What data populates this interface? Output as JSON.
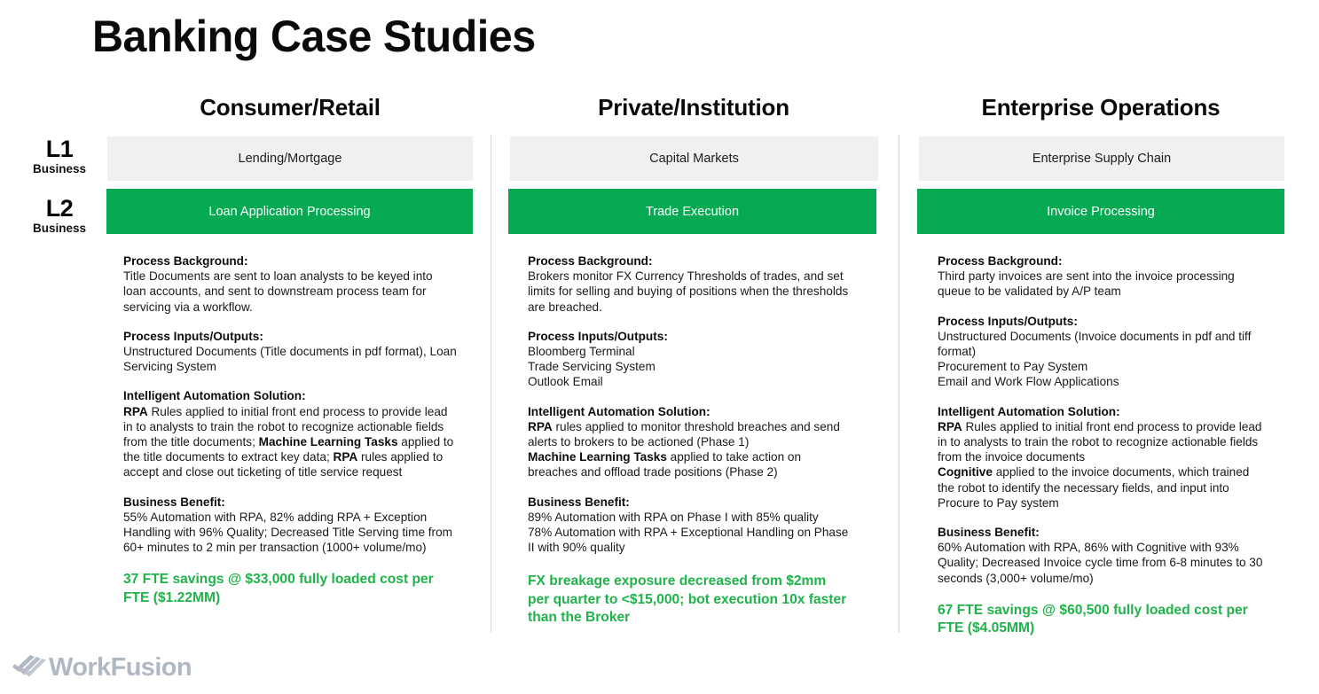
{
  "slide": {
    "title": "Banking Case Studies",
    "accent_green": "#06aa52",
    "highlight_green": "#21b24b",
    "l1_bar_color": "#f0f0f0",
    "logo_color": "#b0b8c4"
  },
  "levels": [
    {
      "code": "L1",
      "sub": "Business"
    },
    {
      "code": "L2",
      "sub": "Business"
    }
  ],
  "columns": [
    {
      "header": "Consumer/Retail",
      "l1": "Lending/Mortgage",
      "l2": "Loan Application Processing",
      "sections": [
        {
          "heading": "Process Background:",
          "body": "Title Documents are sent to loan analysts to be keyed into loan accounts, and sent to downstream process team for servicing via a workflow."
        },
        {
          "heading": "Process Inputs/Outputs:",
          "body": "Unstructured Documents (Title documents in pdf format), Loan Servicing System"
        },
        {
          "heading": "Intelligent Automation Solution:",
          "body_html": "<b>RPA</b> Rules applied to initial front end process to provide lead in to analysts to train the robot to recognize actionable fields from the title documents; <b>Machine Learning Tasks</b> applied to the title documents to extract key data; <b>RPA</b> rules applied to accept and close out ticketing of title service request"
        },
        {
          "heading": "Business Benefit:",
          "body": "55% Automation with RPA, 82% adding RPA + Exception Handling with 96% Quality; Decreased Title Serving time from 60+ minutes to 2 min per transaction (1000+ volume/mo)"
        }
      ],
      "highlight": "37 FTE savings @ $33,000 fully loaded cost per FTE ($1.22MM)"
    },
    {
      "header": "Private/Institution",
      "l1": "Capital Markets",
      "l2": "Trade Execution",
      "sections": [
        {
          "heading": "Process Background:",
          "body": "Brokers monitor FX Currency Thresholds of trades, and set limits for selling and buying of positions when the thresholds are breached."
        },
        {
          "heading": "Process Inputs/Outputs:",
          "body": "Bloomberg Terminal\nTrade Servicing System\nOutlook Email"
        },
        {
          "heading": "Intelligent Automation Solution:",
          "body_html": "<b>RPA</b> rules applied to monitor threshold breaches and send alerts to brokers to be actioned (Phase 1)<br><b>Machine Learning Tasks</b> applied to take action on breaches and offload trade positions (Phase 2)"
        },
        {
          "heading": "Business Benefit:",
          "body": "89% Automation with RPA on Phase I with 85% quality\n78% Automation with RPA + Exceptional Handling on Phase II with 90% quality"
        }
      ],
      "highlight": "FX breakage exposure decreased from $2mm per quarter to <$15,000; bot execution 10x faster than the Broker"
    },
    {
      "header": "Enterprise Operations",
      "l1": "Enterprise Supply Chain",
      "l2": "Invoice Processing",
      "sections": [
        {
          "heading": "Process Background:",
          "body": "Third party invoices are sent into the invoice processing queue to be validated by A/P team"
        },
        {
          "heading": "Process Inputs/Outputs:",
          "body": "Unstructured Documents (Invoice documents in pdf and tiff format)\nProcurement to Pay System\nEmail and Work Flow Applications"
        },
        {
          "heading": "Intelligent Automation Solution:",
          "body_html": "<b>RPA</b> Rules applied to initial front end process to provide lead in to analysts to train the robot to recognize actionable fields from the invoice documents<br><b>Cognitive</b> applied to the invoice documents, which trained the robot to identify the necessary fields, and input into Procure to Pay system"
        },
        {
          "heading": "Business Benefit:",
          "body": "60% Automation with RPA, 86% with Cognitive with 93% Quality; Decreased Invoice cycle time from 6-8 minutes to 30 seconds (3,000+ volume/mo)"
        }
      ],
      "highlight": "67 FTE savings @ $60,500 fully loaded cost per FTE ($4.05MM)"
    }
  ],
  "footer": {
    "logo_text": "WorkFusion",
    "logo_icon": "double-check-swoosh-icon"
  }
}
